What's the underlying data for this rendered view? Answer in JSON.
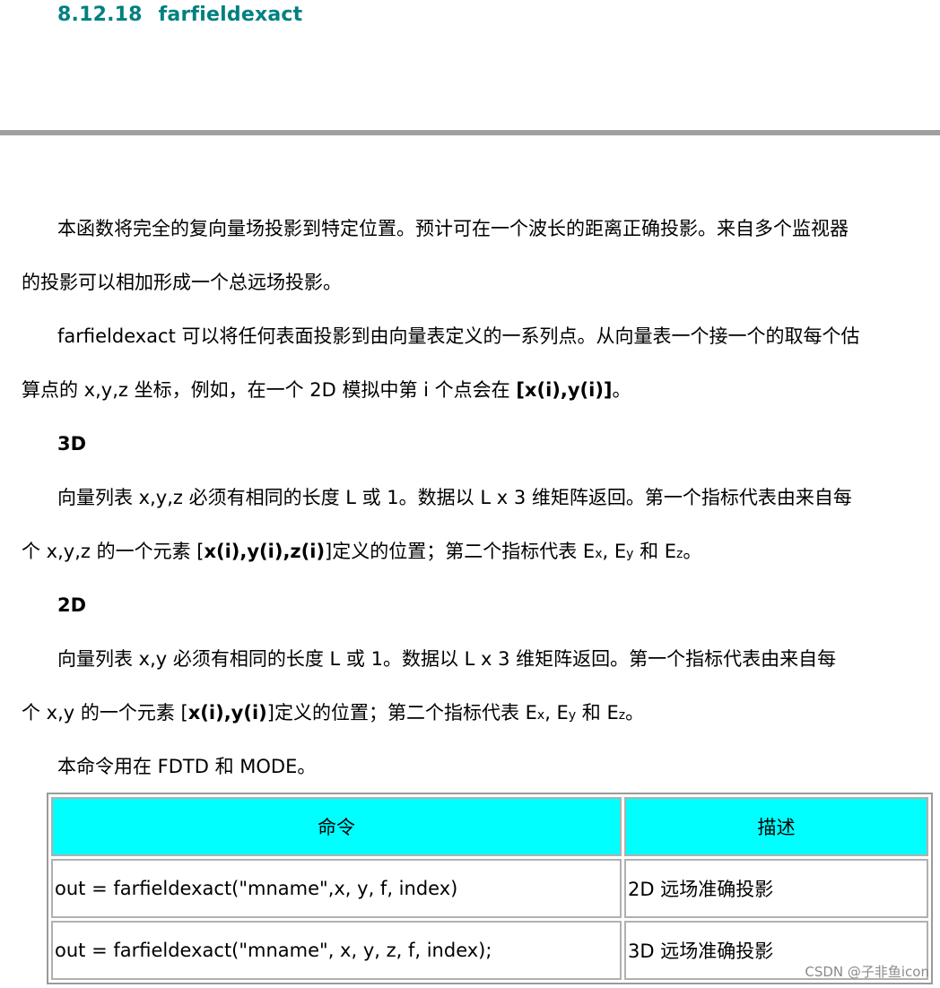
{
  "section": {
    "number": "8.12.18",
    "name": "farfieldexact"
  },
  "paragraphs": {
    "p1_line1": "本函数将完全的复向量场投影到特定位置。预计可在一个波长的距离正确投影。来自多个监视器",
    "p1_line2": "的投影可以相加形成一个总远场投影。",
    "p2_line1": "farfieldexact 可以将任何表面投影到由向量表定义的一系列点。从向量表一个接一个的取每个估",
    "p2_line2_pre": "算点的  x,y,z  坐标，例如，在一个 2D 模拟中第 i 个点会在  ",
    "p2_line2_bold": "[x(i),y(i)]",
    "p2_line2_post": "。"
  },
  "headings": {
    "h3d": "3D",
    "h2d": "2D"
  },
  "section3d": {
    "line1": "向量列表  x,y,z  必须有相同的长度  L  或  1。数据以 L x 3 维矩阵返回。第一个指标代表由来自每",
    "line2_pre": "个 x,y,z  的一个元素  [",
    "line2_bold": "x(i),y(i),z(i)",
    "line2_mid": "]定义的位置；第二个指标代表  E",
    "sub_x": "x",
    "sep1": ", E",
    "sub_y": "y",
    "and": "  和  E",
    "sub_z": "z",
    "end": "。"
  },
  "section2d": {
    "line1": "向量列表  x,y  必须有相同的长度  L  或  1。数据以 L x 3 维矩阵返回。第一个指标代表由来自每",
    "line2_pre": "个 x,y  的一个元素  [",
    "line2_bold": "x(i),y(i)",
    "line2_mid": "]定义的位置；第二个指标代表  E",
    "sub_x": "x",
    "sep1": ", E",
    "sub_y": "y",
    "and": "  和  E",
    "sub_z": "z",
    "end": "。"
  },
  "usage": "本命令用在  FDTD  和  MODE。",
  "table": {
    "header_command": "命令",
    "header_description": "描述",
    "rows": [
      {
        "command": "out = farfieldexact(\"mname\",x, y, f, index)",
        "description": "2D  远场准确投影"
      },
      {
        "command": "out = farfieldexact(\"mname\", x, y, z, f, index);",
        "description": "3D  远场准确投影"
      }
    ]
  },
  "watermark": "CSDN @子非鱼icon",
  "colors": {
    "title": "#008080",
    "table_header_bg": "#00ffff",
    "divider": "#a0a0a0"
  }
}
